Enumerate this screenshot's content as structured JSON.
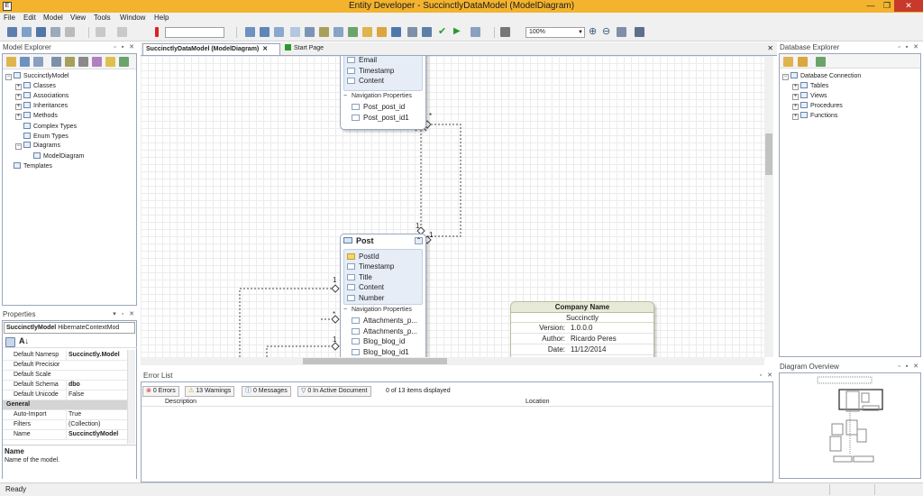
{
  "window": {
    "title": "Entity Developer - SuccinctlyDataModel (ModelDiagram)",
    "controls": [
      "—",
      "❐",
      "✕"
    ]
  },
  "menu": [
    "File",
    "Edit",
    "Model",
    "View",
    "Tools",
    "Window",
    "Help"
  ],
  "toolbar": {
    "zoom": "100%"
  },
  "model_explorer": {
    "title": "Model Explorer",
    "tree": [
      {
        "label": "SuccinctlyModel",
        "indent": 0,
        "pm": "−"
      },
      {
        "label": "Classes",
        "indent": 1,
        "pm": "+"
      },
      {
        "label": "Associations",
        "indent": 1,
        "pm": "+"
      },
      {
        "label": "Inheritances",
        "indent": 1,
        "pm": "+"
      },
      {
        "label": "Methods",
        "indent": 1,
        "pm": "+"
      },
      {
        "label": "Complex Types",
        "indent": 1,
        "pm": ""
      },
      {
        "label": "Enum Types",
        "indent": 1,
        "pm": ""
      },
      {
        "label": "Diagrams",
        "indent": 1,
        "pm": "−"
      },
      {
        "label": "ModelDiagram",
        "indent": 2,
        "pm": ""
      },
      {
        "label": "Templates",
        "indent": 0,
        "pm": ""
      }
    ]
  },
  "properties": {
    "title": "Properties",
    "object_name": "SuccinctlyModel",
    "object_type": "HibernateContextMod",
    "rows": [
      {
        "k": "Default Namesp",
        "v": "Succinctly.Model",
        "bold": true
      },
      {
        "k": "Default Precisior",
        "v": ""
      },
      {
        "k": "Default Scale",
        "v": ""
      },
      {
        "k": "Default Schema",
        "v": "dbo",
        "bold": true
      },
      {
        "k": "Default Unicode",
        "v": "False"
      },
      {
        "k": "General",
        "v": "",
        "cat": true
      },
      {
        "k": "Auto-Import",
        "v": "True"
      },
      {
        "k": "Filters",
        "v": "(Collection)"
      },
      {
        "k": "Name",
        "v": "SuccinctlyModel",
        "bold": true
      }
    ],
    "desc_title": "Name",
    "desc_text": "Name of the model."
  },
  "tabs": [
    {
      "label": "SuccinctlyDataModel (ModelDiagram)",
      "active": true
    },
    {
      "label": "Start Page",
      "active": false
    }
  ],
  "diagram": {
    "top_entity": {
      "fields": [
        "Email",
        "Timestamp",
        "Content"
      ],
      "nav_label": "Navigation Properties",
      "nav": [
        "Post_post_id",
        "Post_post_id1"
      ]
    },
    "post_entity": {
      "name": "Post",
      "fields": [
        "PostId",
        "Timestamp",
        "Title",
        "Content",
        "Number"
      ],
      "nav_label": "Navigation Properties",
      "nav": [
        "Attachments_p...",
        "Attachments_p...",
        "Blog_blog_id",
        "Blog_blog_id1"
      ]
    },
    "company": {
      "title": "Company Name",
      "subtitle": "Succinctly",
      "rows": [
        {
          "k": "Version:",
          "v": "1.0.0.0"
        },
        {
          "k": "Author:",
          "v": "Ricardo Peres"
        },
        {
          "k": "Date:",
          "v": "11/12/2014"
        }
      ]
    },
    "multiplicity": {
      "star": "*",
      "one": "1"
    }
  },
  "error_list": {
    "title": "Error List",
    "errors": "0 Errors",
    "warnings": "13 Warnings",
    "messages": "0 Messages",
    "filter": "0 In Active Document",
    "summary": "0 of 13 items displayed",
    "col_description": "Description",
    "col_location": "Location"
  },
  "database_explorer": {
    "title": "Database Explorer",
    "tree": [
      {
        "label": "Database Connection",
        "indent": 0,
        "pm": "−"
      },
      {
        "label": "Tables",
        "indent": 1,
        "pm": "+"
      },
      {
        "label": "Views",
        "indent": 1,
        "pm": "+"
      },
      {
        "label": "Procedures",
        "indent": 1,
        "pm": "+"
      },
      {
        "label": "Functions",
        "indent": 1,
        "pm": "+"
      }
    ]
  },
  "diagram_overview": {
    "title": "Diagram Overview"
  },
  "statusbar": {
    "text": "Ready"
  }
}
